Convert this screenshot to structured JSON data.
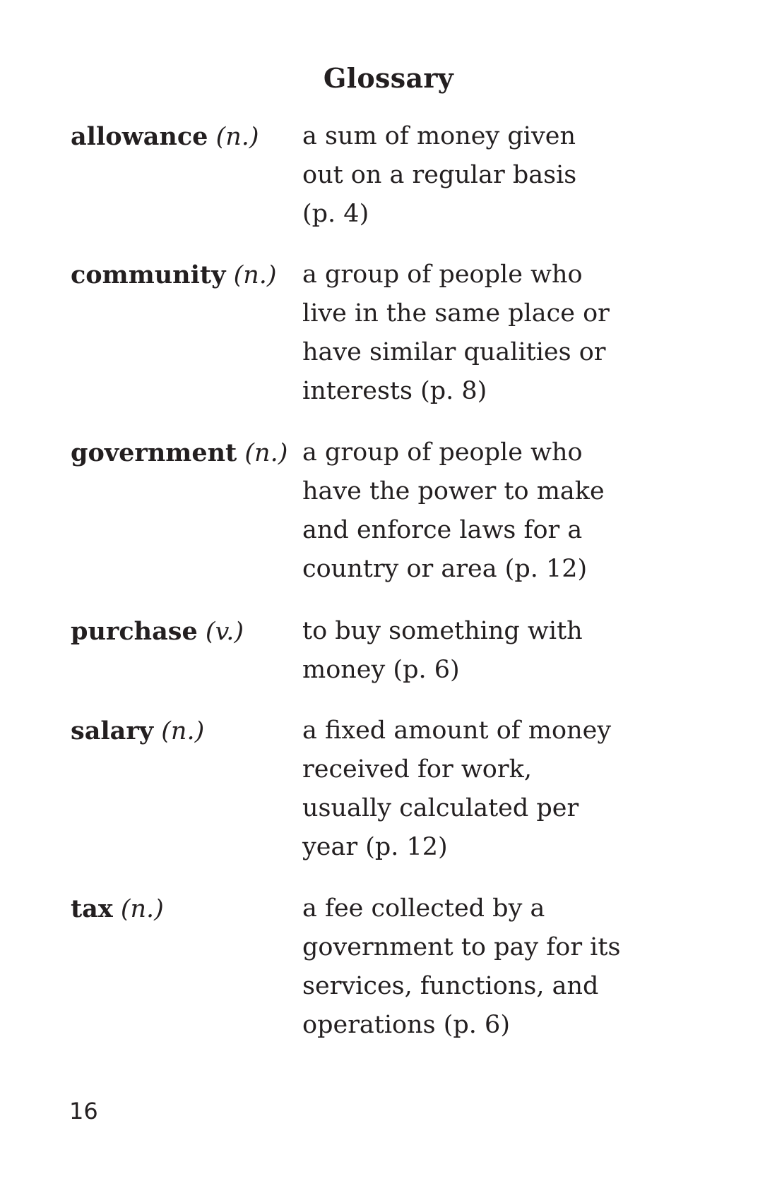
{
  "title": "Glossary",
  "entries": [
    {
      "term": "allowance",
      "pos": "(n.)",
      "definition": "a sum of money given\nout on a regular basis\n(p. 4)"
    },
    {
      "term": "community",
      "pos": "(n.)",
      "definition": "a group of people who\nlive in the same place or\nhave similar qualities or\ninterests (p. 8)"
    },
    {
      "term": "government",
      "pos": "(n.)",
      "definition": "a group of people who\nhave the power to make\nand enforce laws for a\ncountry or area (p. 12)"
    },
    {
      "term": "purchase",
      "pos": "(v.)",
      "definition": "to buy something with\nmoney (p. 6)"
    },
    {
      "term": "salary",
      "pos": "(n.)",
      "definition": "a fixed amount of money\nreceived for work,\nusually calculated per\nyear (p. 12)"
    },
    {
      "term": "tax",
      "pos": "(n.)",
      "definition": "a fee collected by a\ngovernment to pay for its\nservices, functions, and\noperations (p. 6)"
    }
  ],
  "page_number": "16"
}
